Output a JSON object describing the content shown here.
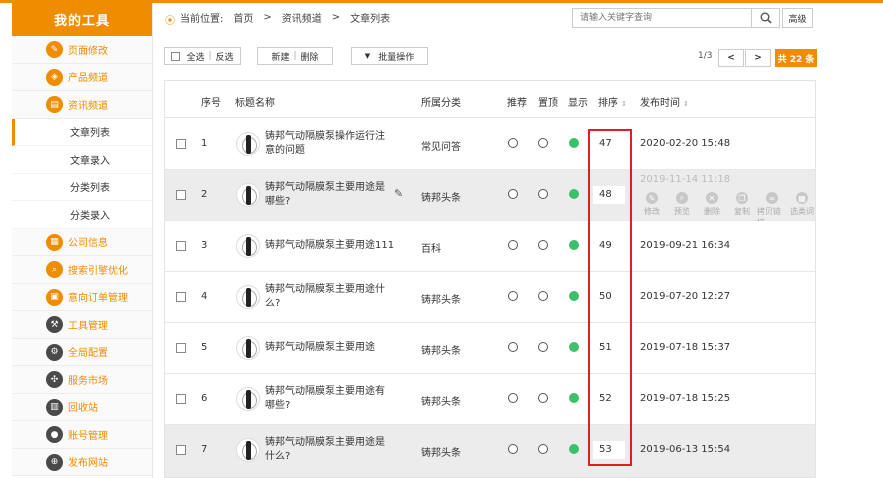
{
  "sidebar": {
    "brand": "我的工具",
    "items": [
      {
        "label": "页面修改",
        "icon": "edit-icon"
      },
      {
        "label": "产品频道",
        "icon": "product-icon"
      },
      {
        "label": "资讯频道",
        "icon": "news-icon"
      },
      {
        "label": "公司信息",
        "icon": "company-icon"
      },
      {
        "label": "搜索引擎优化",
        "icon": "search-icon"
      },
      {
        "label": "意向订单管理",
        "icon": "order-icon"
      },
      {
        "label": "工具管理",
        "icon": "wrench-icon"
      },
      {
        "label": "全局配置",
        "icon": "gear-icon"
      },
      {
        "label": "服务市场",
        "icon": "grid-icon"
      },
      {
        "label": "回收站",
        "icon": "trash-icon"
      },
      {
        "label": "账号管理",
        "icon": "user-icon"
      },
      {
        "label": "发布网站",
        "icon": "globe-icon"
      }
    ],
    "sub_items": [
      "文章列表",
      "文章录入",
      "分类列表",
      "分类录入"
    ]
  },
  "breadcrumb": {
    "prefix": "当前位置:",
    "crumbs": [
      "首页",
      ">",
      "资讯频道",
      ">",
      "文章列表"
    ]
  },
  "search": {
    "placeholder": "请输入关键字查询",
    "advanced": "高级"
  },
  "toolbar": {
    "select_all": "全选",
    "sep": "|",
    "invert": "反选",
    "new": "新建",
    "delete": "删除",
    "batch": "批量操作"
  },
  "pager": {
    "page": "1/3",
    "prev": "<",
    "next": ">",
    "total": "共 22 条"
  },
  "table": {
    "headers": {
      "index": "序号",
      "title": "标题名称",
      "category": "所属分类",
      "recommend": "推荐",
      "top": "置顶",
      "show": "显示",
      "sort": "排序",
      "date": "发布时间"
    },
    "rows": [
      {
        "index": "1",
        "title": "铸邦气动隔膜泵操作运行注意的问题",
        "category": "常见问答",
        "sort": "47",
        "date": "2020-02-20 15:48"
      },
      {
        "index": "2",
        "title": "铸邦气动隔膜泵主要用途是哪些?",
        "category": "铸邦头条",
        "sort": "48",
        "date": "2019-11-14 11:18"
      },
      {
        "index": "3",
        "title": "铸邦气动隔膜泵主要用途111",
        "category": "百科",
        "sort": "49",
        "date": "2019-09-21 16:34"
      },
      {
        "index": "4",
        "title": "铸邦气动隔膜泵主要用途什么?",
        "category": "铸邦头条",
        "sort": "50",
        "date": "2019-07-20 12:27"
      },
      {
        "index": "5",
        "title": "铸邦气动隔膜泵主要用途",
        "category": "铸邦头条",
        "sort": "51",
        "date": "2019-07-18 15:37"
      },
      {
        "index": "6",
        "title": "铸邦气动隔膜泵主要用途有哪些?",
        "category": "铸邦头条",
        "sort": "52",
        "date": "2019-07-18 15:25"
      },
      {
        "index": "7",
        "title": "铸邦气动隔膜泵主要用途是什么?",
        "category": "铸邦头条",
        "sort": "53",
        "date": "2019-06-13 15:54"
      }
    ],
    "row_actions": [
      "修改",
      "预览",
      "删除",
      "复制",
      "拷贝链接",
      "选类词"
    ]
  },
  "colors": {
    "accent": "#f08c00",
    "status_on": "#3dbf6b",
    "highlight": "#e02020"
  }
}
